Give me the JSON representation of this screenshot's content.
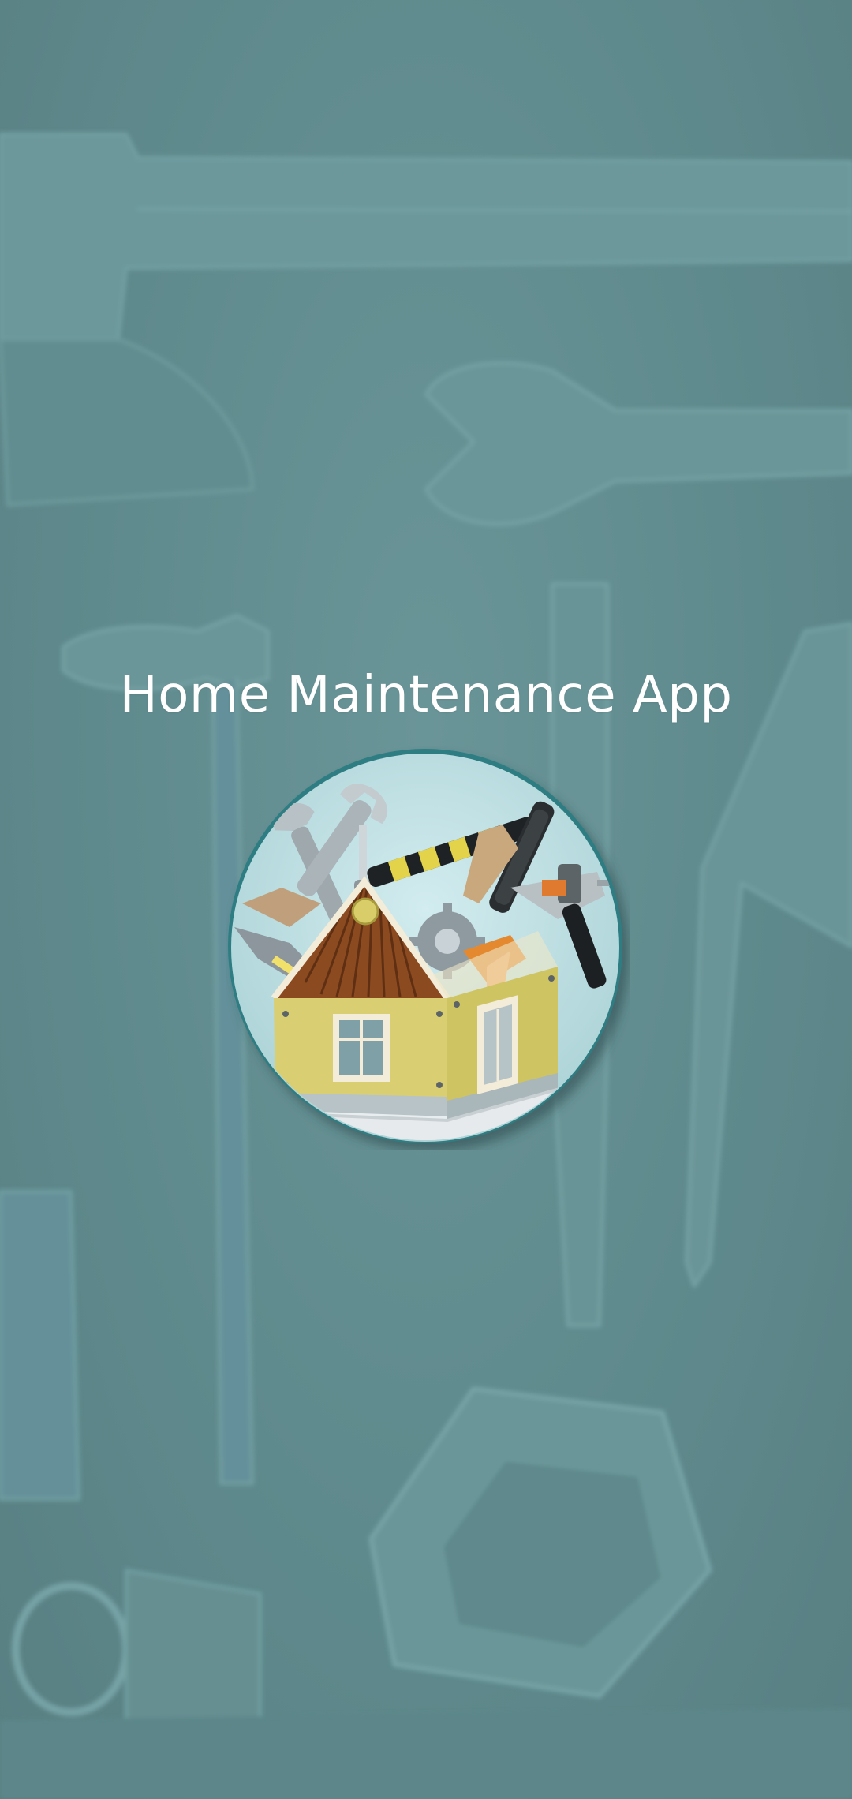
{
  "app": {
    "title": "Home Maintenance App"
  },
  "logo": {
    "icon": "house-toolbox-icon"
  },
  "background": {
    "pattern": "embossed-tools",
    "color": "#5f8a8d"
  },
  "colors": {
    "background": "#5f8a8d",
    "title_text": "#ffffff",
    "logo_ring": "#2f7d82",
    "logo_inner": "#c3e0e3"
  }
}
